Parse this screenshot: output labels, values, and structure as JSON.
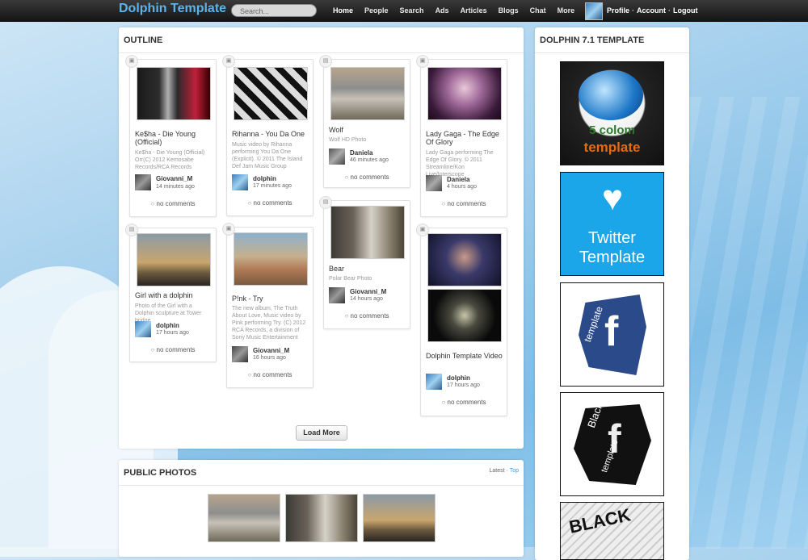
{
  "header": {
    "logo": "Dolphin Template",
    "search_placeholder": "Search...",
    "nav": [
      "Home",
      "People",
      "Search",
      "Ads",
      "Articles",
      "Blogs",
      "Chat",
      "More"
    ],
    "user_menu": [
      "Profile",
      "Account",
      "Logout"
    ]
  },
  "outline": {
    "title": "OUTLINE",
    "load_more": "Load More",
    "cards": [
      {
        "title": "Ke$ha - Die Young (Official)",
        "desc": "Ke$ha - Die Young (Official) Orr(C) 2012 Kemosabe Records/RCA Records",
        "author": "Giovanni_M",
        "time": "14 minutes ago",
        "comments": "no comments"
      },
      {
        "title": "Rihanna - You Da One",
        "desc": "Music video by Rihanna performing You Da One (Explicit). © 2011 The Island Def Jam Music Group",
        "author": "dolphin",
        "time": "17 minutes ago",
        "comments": "no comments"
      },
      {
        "title": "Wolf",
        "desc": "Wolf HD Photo",
        "author": "Daniela",
        "time": "46 minutes ago",
        "comments": "no comments"
      },
      {
        "title": "Lady Gaga - The Edge Of Glory",
        "desc": "Lady Gaga performing The Edge Of Glory. © 2011 Streamline/Kon Live/Interscope",
        "author": "Daniela",
        "time": "4 hours ago",
        "comments": "no comments"
      },
      {
        "title": "Girl with a dolphin",
        "desc": "Photo of the Girl with a Dolphin sculpture at Tower bridge",
        "author": "dolphin",
        "time": "17 hours ago",
        "comments": "no comments"
      },
      {
        "title": "P!nk - Try",
        "desc": "The new album, The Truth About Love, Music video by Pink performing Try. (C) 2012 RCA Records, a division of Sony Music Entertainment",
        "author": "Giovanni_M",
        "time": "16 hours ago",
        "comments": "no comments"
      },
      {
        "title": "Bear",
        "desc": "Polar Bear Photo",
        "author": "Giovanni_M",
        "time": "14 hours ago",
        "comments": "no comments"
      },
      {
        "title": "Dolphin Template Video",
        "desc": "",
        "author": "dolphin",
        "time": "17 hours ago",
        "comments": "no comments"
      }
    ]
  },
  "photos": {
    "title": "PUBLIC PHOTOS",
    "tab_latest": "Latest",
    "separator": "·",
    "tab_top": "Top"
  },
  "sidebar": {
    "title": "DOLPHIN 7.1 TEMPLATE",
    "items": [
      {
        "line1": "5 colom",
        "line2": "template"
      },
      {
        "line1": "Twitter",
        "line2": "Template"
      },
      {
        "line1": "template",
        "line2": "f"
      },
      {
        "line1": "Black",
        "line2": "template"
      },
      {
        "line1": "BLACK",
        "line2": ""
      }
    ]
  }
}
